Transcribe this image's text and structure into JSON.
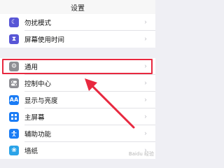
{
  "header": {
    "title": "设置"
  },
  "group1": [
    {
      "label": "勿扰模式",
      "icon": "moon-icon",
      "color": "#5856d6"
    },
    {
      "label": "屏幕使用时间",
      "icon": "hourglass-icon",
      "color": "#5856d6"
    }
  ],
  "group2": [
    {
      "label": "通用",
      "icon": "gear-icon",
      "color": "#8e8e93"
    },
    {
      "label": "控制中心",
      "icon": "toggles-icon",
      "color": "#8e8e93"
    },
    {
      "label": "显示与亮度",
      "icon": "text-size-icon",
      "color": "#1a7cf5"
    },
    {
      "label": "主屏幕",
      "icon": "home-grid-icon",
      "color": "#1a7cf5"
    },
    {
      "label": "辅助功能",
      "icon": "accessibility-icon",
      "color": "#1a7cf5"
    },
    {
      "label": "墙纸",
      "icon": "flower-icon",
      "color": "#2aa3e8"
    }
  ],
  "highlight_color": "#e8283f",
  "watermark": "Baidu 经验"
}
